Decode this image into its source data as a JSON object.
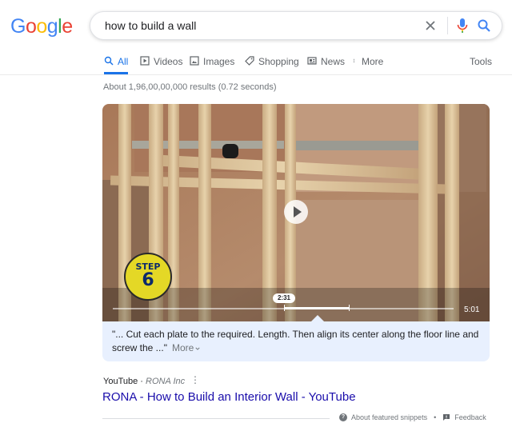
{
  "logo": {
    "letters": [
      "G",
      "o",
      "o",
      "g",
      "l",
      "e"
    ],
    "colors": [
      "#4285f4",
      "#ea4335",
      "#fbbc05",
      "#4285f4",
      "#34a853",
      "#ea4335"
    ]
  },
  "search": {
    "query": "how to build a wall",
    "placeholder": ""
  },
  "tabs": [
    {
      "label": "All",
      "icon": "search-icon",
      "active": true
    },
    {
      "label": "Videos",
      "icon": "video-play-icon",
      "active": false
    },
    {
      "label": "Images",
      "icon": "image-icon",
      "active": false
    },
    {
      "label": "Shopping",
      "icon": "tag-icon",
      "active": false
    },
    {
      "label": "News",
      "icon": "newspaper-icon",
      "active": false
    },
    {
      "label": "More",
      "icon": "vertical-dots-icon",
      "active": false
    }
  ],
  "tools_label": "Tools",
  "result_stats": "About 1,96,00,00,000 results (0.72 seconds)",
  "video": {
    "step_word": "STEP",
    "step_number": "6",
    "current_time": "2:31",
    "duration": "5:01",
    "playhead_fraction": 0.5,
    "segment_end_fraction": 0.69
  },
  "snippet": {
    "text": "\"... Cut each plate to the required. Length. Then align its center along the floor line and screw the ...\"",
    "more_label": "More"
  },
  "result": {
    "source": "YouTube",
    "separator": " · ",
    "channel": "RONA Inc",
    "menu_glyph": "⋮",
    "title": "RONA - How to Build an Interior Wall - YouTube"
  },
  "footer": {
    "about_label": "About featured snippets",
    "bullet": "•",
    "feedback_label": "Feedback"
  },
  "colors": {
    "link_blue": "#1a0dab",
    "accent_blue": "#1a73e8",
    "snippet_bg": "#e8f0fe"
  }
}
